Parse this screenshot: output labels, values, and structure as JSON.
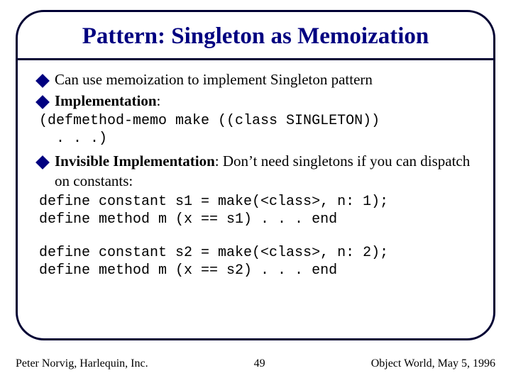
{
  "title": "Pattern: Singleton as Memoization",
  "bullets": {
    "b1": "Can use memoization to implement Singleton pattern",
    "b2_lead": "Implementation",
    "b2_rest": ":",
    "b3_lead": "Invisible Implementation",
    "b3_rest": ": Don’t need singletons if you can dispatch on constants:"
  },
  "code": {
    "block1": "(defmethod-memo make ((class SINGLETON))\n  . . .)",
    "block2": "define constant s1 = make(<class>, n: 1);\ndefine method m (x == s1) . . . end",
    "block3": "define constant s2 = make(<class>, n: 2);\ndefine method m (x == s2) . . . end"
  },
  "footer": {
    "left": "Peter Norvig, Harlequin, Inc.",
    "center": "49",
    "right": "Object World, May 5, 1996"
  }
}
